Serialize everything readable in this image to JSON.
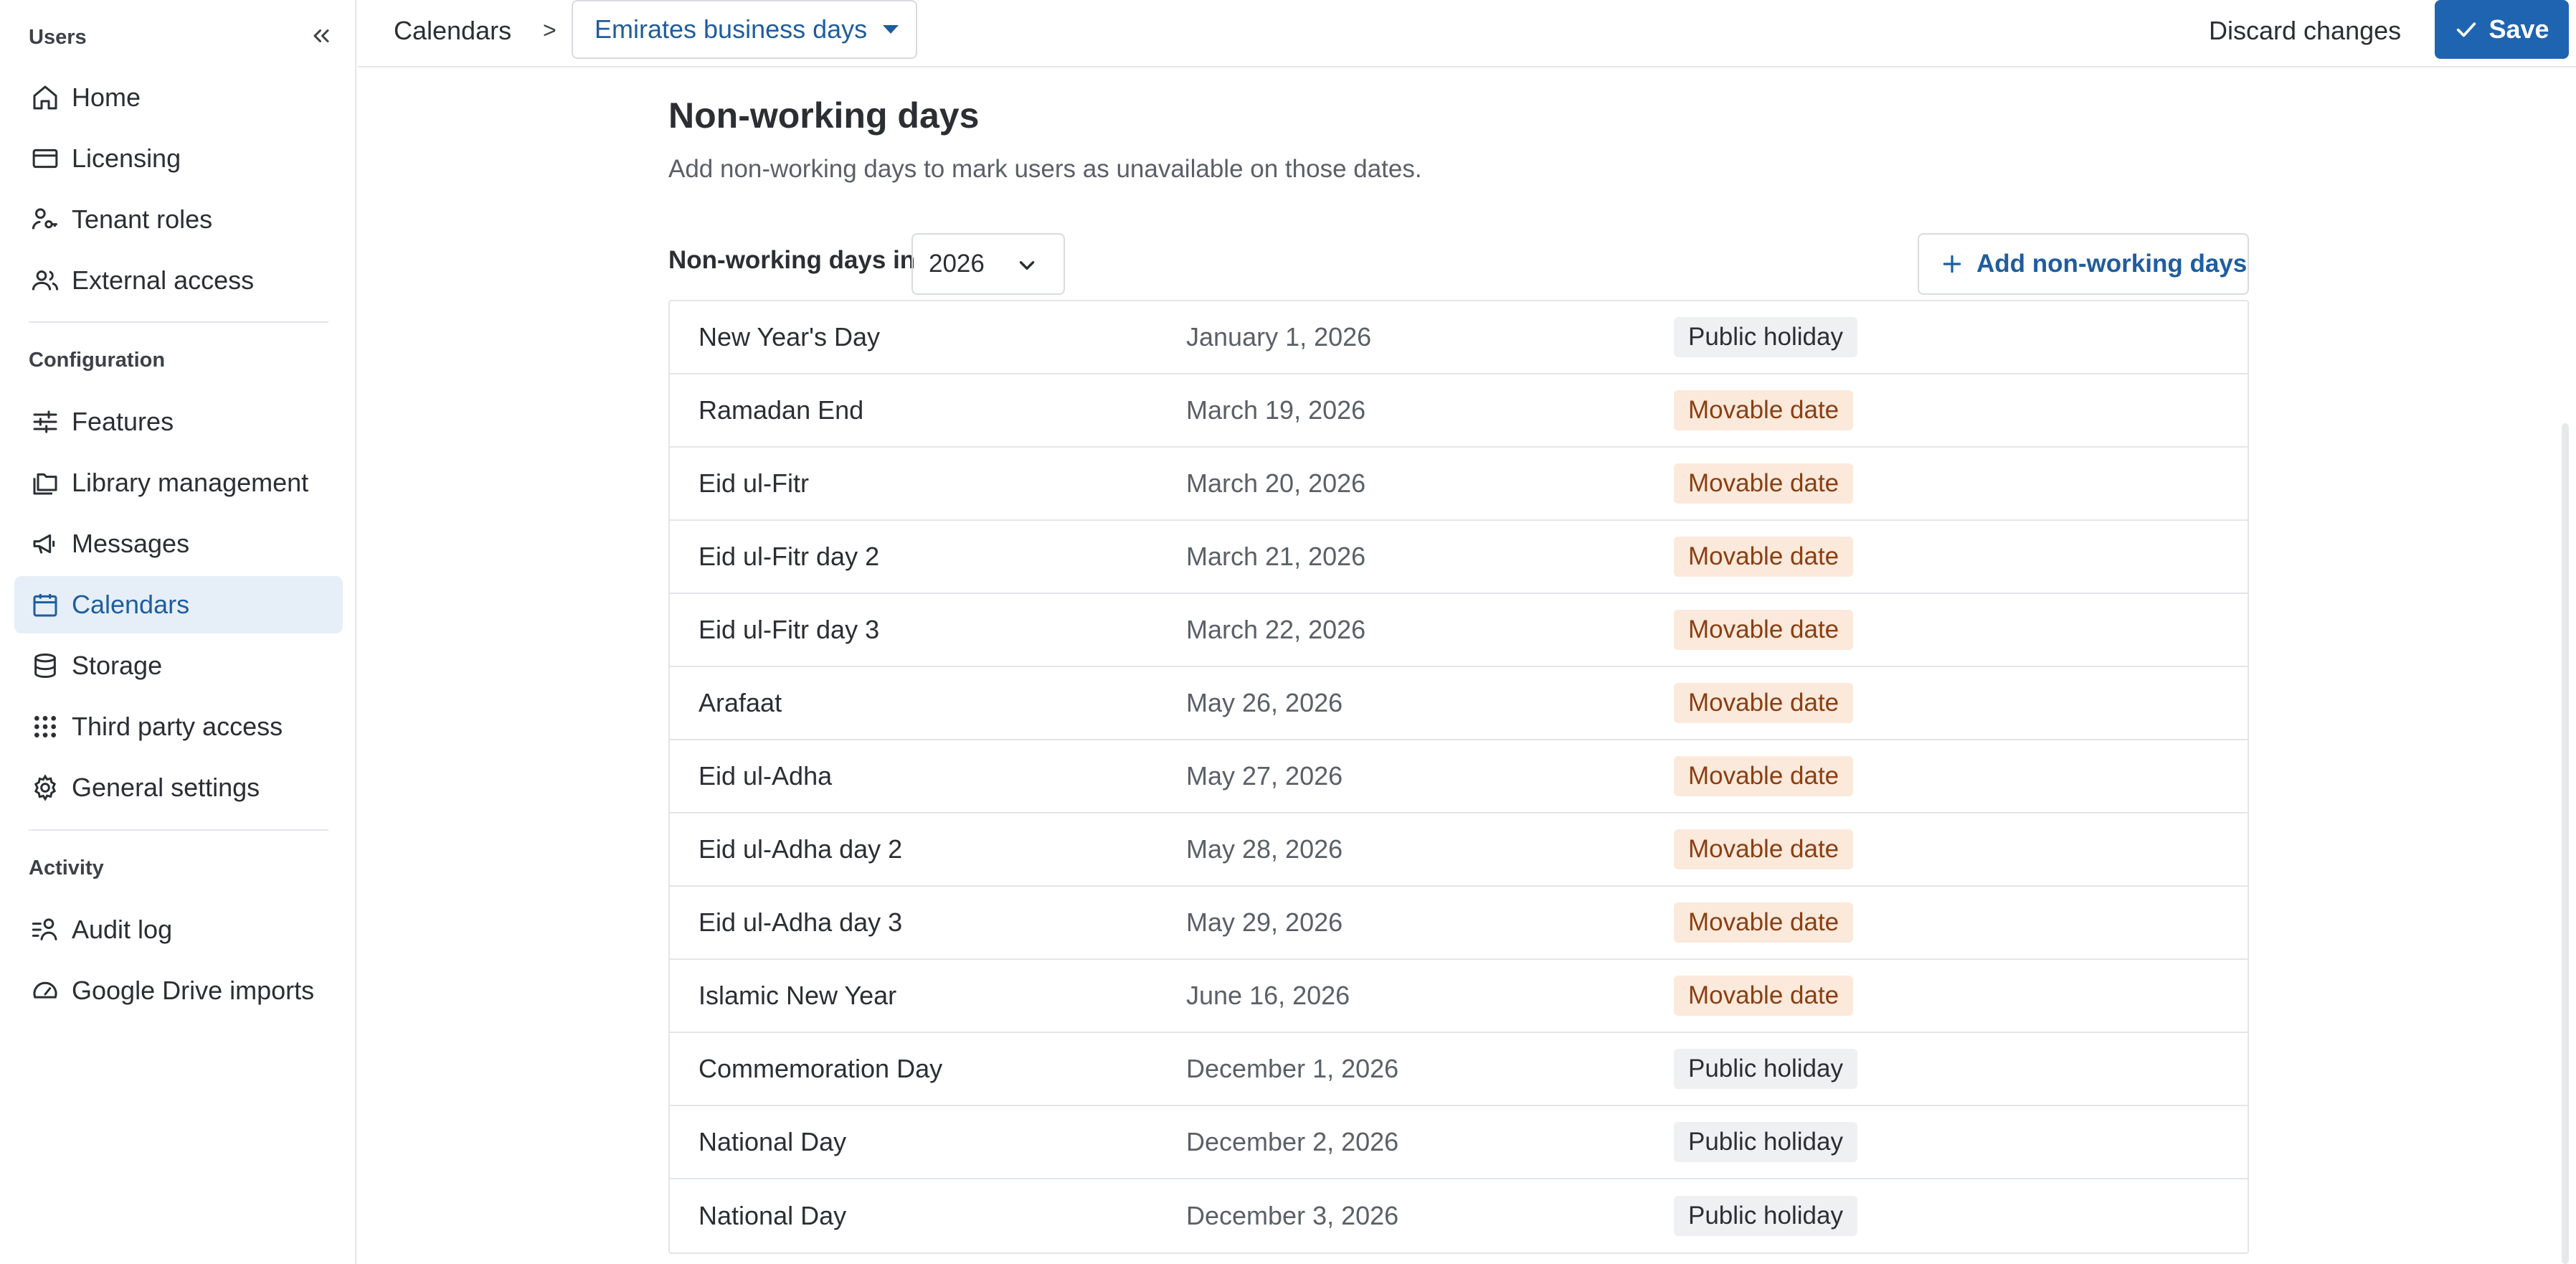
{
  "sidebar": {
    "sections": [
      {
        "label": "Users",
        "items": [
          "Home",
          "Licensing",
          "Tenant roles",
          "External access"
        ]
      },
      {
        "label": "Configuration",
        "items": [
          "Features",
          "Library management",
          "Messages",
          "Calendars",
          "Storage",
          "Third party access",
          "General settings"
        ]
      },
      {
        "label": "Activity",
        "items": [
          "Audit log",
          "Google Drive imports"
        ]
      }
    ],
    "active_item": "Calendars"
  },
  "header": {
    "breadcrumb_root": "Calendars",
    "breadcrumb_separator": ">",
    "calendar_name": "Emirates business days",
    "discard_label": "Discard changes",
    "save_label": "Save"
  },
  "main": {
    "title": "Non-working days",
    "subtitle": "Add non-working days to mark users as unavailable on those dates.",
    "year_label": "Non-working days in",
    "year_value": "2026",
    "add_button_label": "Add non-working days",
    "rows": [
      {
        "name": "New Year's Day",
        "date": "January 1, 2026",
        "type": "Public holiday"
      },
      {
        "name": "Ramadan End",
        "date": "March 19, 2026",
        "type": "Movable date"
      },
      {
        "name": "Eid ul-Fitr",
        "date": "March 20, 2026",
        "type": "Movable date"
      },
      {
        "name": "Eid ul-Fitr day 2",
        "date": "March 21, 2026",
        "type": "Movable date"
      },
      {
        "name": "Eid ul-Fitr day 3",
        "date": "March 22, 2026",
        "type": "Movable date"
      },
      {
        "name": "Arafaat",
        "date": "May 26, 2026",
        "type": "Movable date"
      },
      {
        "name": "Eid ul-Adha",
        "date": "May 27, 2026",
        "type": "Movable date"
      },
      {
        "name": "Eid ul-Adha day 2",
        "date": "May 28, 2026",
        "type": "Movable date"
      },
      {
        "name": "Eid ul-Adha day 3",
        "date": "May 29, 2026",
        "type": "Movable date"
      },
      {
        "name": "Islamic New Year",
        "date": "June 16, 2026",
        "type": "Movable date"
      },
      {
        "name": "Commemoration Day",
        "date": "December 1, 2026",
        "type": "Public holiday"
      },
      {
        "name": "National Day",
        "date": "December 2, 2026",
        "type": "Public holiday"
      },
      {
        "name": "National Day",
        "date": "December 3, 2026",
        "type": "Public holiday"
      }
    ]
  },
  "colors": {
    "accent": "#1f64b0",
    "link": "#1f5d9e",
    "active_nav_bg": "#e6eff8",
    "public_badge_bg": "#eff0f2",
    "movable_badge_bg": "#fbe9dc",
    "movable_badge_text": "#8a3f12"
  }
}
